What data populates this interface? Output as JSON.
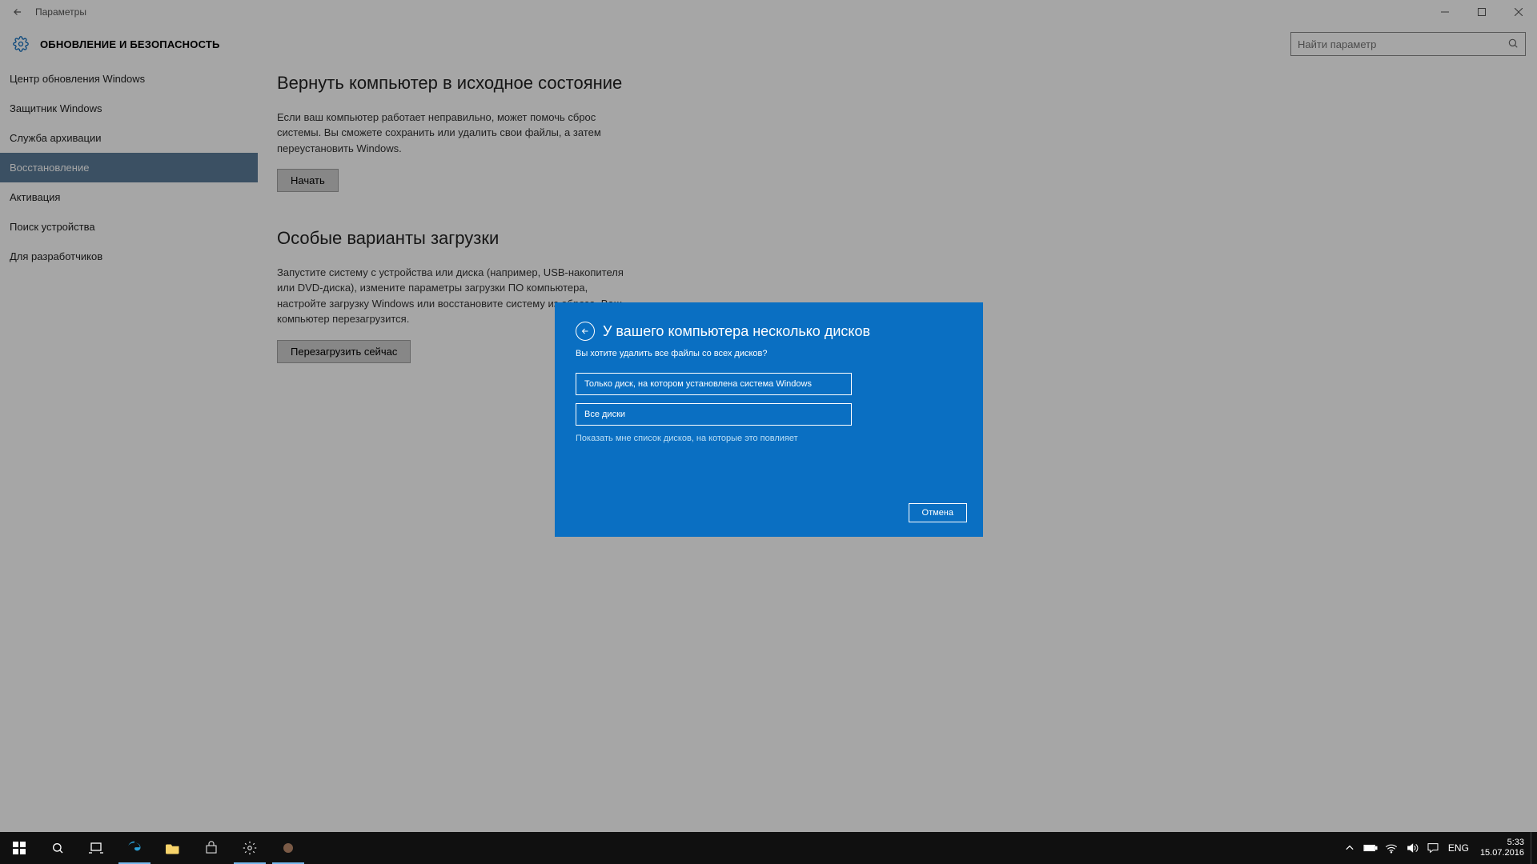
{
  "window": {
    "title": "Параметры",
    "min_tip": "Свернуть",
    "max_tip": "Развернуть",
    "close_tip": "Закрыть"
  },
  "header": {
    "caption": "ОБНОВЛЕНИЕ И БЕЗОПАСНОСТЬ",
    "search_placeholder": "Найти параметр"
  },
  "sidebar": {
    "items": [
      {
        "label": "Центр обновления Windows"
      },
      {
        "label": "Защитник Windows"
      },
      {
        "label": "Служба архивации"
      },
      {
        "label": "Восстановление"
      },
      {
        "label": "Активация"
      },
      {
        "label": "Поиск устройства"
      },
      {
        "label": "Для разработчиков"
      }
    ],
    "selected_index": 3
  },
  "content": {
    "section1": {
      "title": "Вернуть компьютер в исходное состояние",
      "desc": "Если ваш компьютер работает неправильно, может помочь сброс системы. Вы сможете сохранить или удалить свои файлы, а затем переустановить Windows.",
      "button": "Начать"
    },
    "section2": {
      "title": "Особые варианты загрузки",
      "desc": "Запустите систему с устройства или диска (например, USB-накопителя или DVD-диска), измените параметры загрузки ПО компьютера, настройте загрузку Windows или восстановите систему из образа. Ваш компьютер перезагрузится.",
      "button": "Перезагрузить сейчас"
    }
  },
  "modal": {
    "title": "У вашего компьютера несколько дисков",
    "question": "Вы хотите удалить все файлы со всех дисков?",
    "option1": "Только диск, на котором установлена система Windows",
    "option2": "Все диски",
    "link": "Показать мне список дисков, на которые это повлияет",
    "cancel": "Отмена"
  },
  "taskbar": {
    "lang": "ENG",
    "time": "5:33",
    "date": "15.07.2016"
  }
}
